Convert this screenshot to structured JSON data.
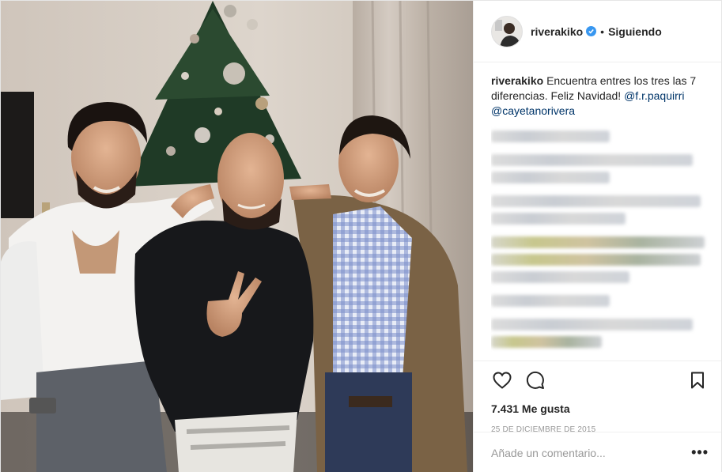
{
  "post": {
    "username": "riverakiko",
    "follow_status": "Siguiendo",
    "separator": "•",
    "caption": {
      "username": "riverakiko",
      "text": "Encuentra entres los tres las 7 diferencias. Feliz Navidad!",
      "mention1": "@f.r.paquirri",
      "mention2": "@cayetanorivera"
    },
    "likes": "7.431 Me gusta",
    "date": "25 DE DICIEMBRE DE 2015",
    "comment_placeholder": "Añade un comentario...",
    "more_label": "•••"
  },
  "colors": {
    "verified": "#3897f0",
    "mention": "#003569",
    "text": "#262626",
    "muted": "#999999"
  },
  "icons": [
    "verified-badge-icon",
    "heart-icon",
    "comment-icon",
    "bookmark-icon",
    "more-options-icon"
  ]
}
